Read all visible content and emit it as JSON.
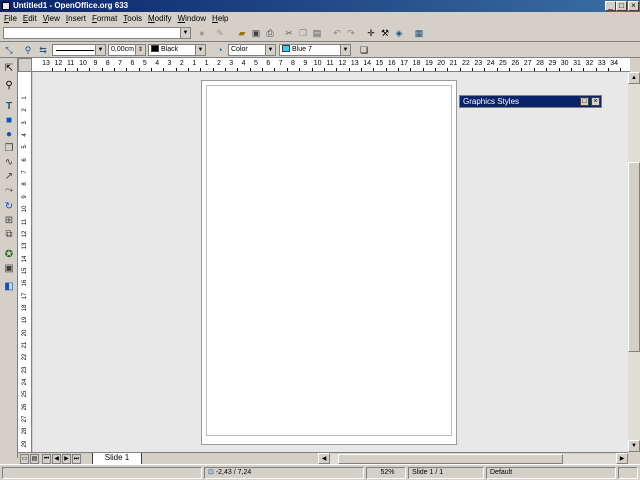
{
  "window": {
    "title": "Untitled1 - OpenOffice.org 633"
  },
  "menu": {
    "items": [
      "File",
      "Edit",
      "View",
      "Insert",
      "Format",
      "Tools",
      "Modify",
      "Window",
      "Help"
    ]
  },
  "object_bar": {
    "line_width": "0,00cm",
    "line_color": "Black",
    "line_color_hex": "#000000",
    "area_style": "Color",
    "area_color": "Blue 7",
    "area_color_hex": "#33ccff"
  },
  "rulers": {
    "horizontal": [
      "13",
      "12",
      "11",
      "10",
      "9",
      "8",
      "7",
      "6",
      "5",
      "4",
      "3",
      "2",
      "1",
      "1",
      "2",
      "3",
      "4",
      "5",
      "6",
      "7",
      "8",
      "9",
      "10",
      "11",
      "12",
      "13",
      "14",
      "15",
      "16",
      "17",
      "18",
      "19",
      "20",
      "21",
      "22",
      "23",
      "24",
      "25",
      "26",
      "27",
      "28",
      "29",
      "30",
      "31",
      "32",
      "33",
      "34"
    ],
    "vertical": [
      "1",
      "2",
      "3",
      "4",
      "5",
      "6",
      "7",
      "8",
      "9",
      "10",
      "11",
      "12",
      "13",
      "14",
      "15",
      "16",
      "17",
      "18",
      "19",
      "20",
      "21",
      "22",
      "23",
      "24",
      "25",
      "26",
      "27",
      "28",
      "29"
    ]
  },
  "styles_panel": {
    "title": "Graphics Styles"
  },
  "tabs": {
    "slide_tab": "Slide 1"
  },
  "status": {
    "position": "-2,43 / 7,24",
    "zoom": "52%",
    "slide": "Slide 1 / 1",
    "layout": "Default"
  },
  "colors": {
    "titlebar": "#0a246a",
    "chrome": "#d4d0c8",
    "workspace": "#e8e8e8"
  }
}
